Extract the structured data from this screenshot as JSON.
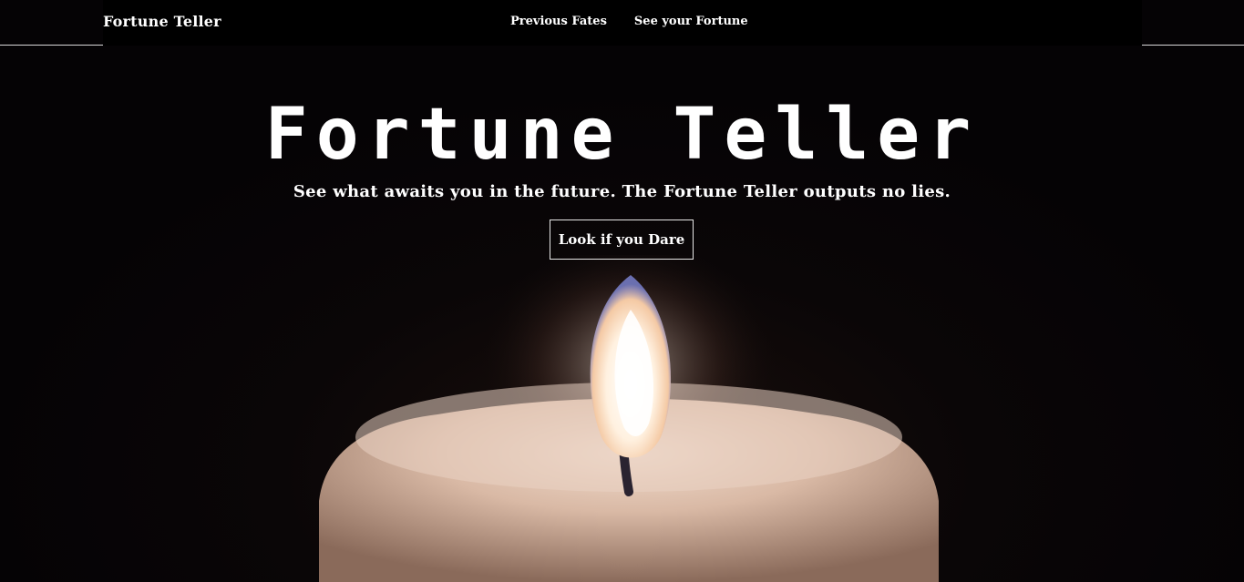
{
  "header": {
    "brand": "Fortune Teller",
    "nav": [
      {
        "label": "Previous Fates"
      },
      {
        "label": "See your Fortune"
      }
    ]
  },
  "hero": {
    "title": "Fortune Teller",
    "subtitle": "See what awaits you in the future. The Fortune Teller outputs no lies.",
    "cta_label": "Look if you Dare"
  },
  "colors": {
    "background": "#050305",
    "text": "#ffffff",
    "button_border": "#e8e8e8",
    "candle_wax": "#d9b9a5",
    "flame_core": "#fff6ec"
  },
  "icons": {
    "hero_image": "candle-flame-image"
  }
}
